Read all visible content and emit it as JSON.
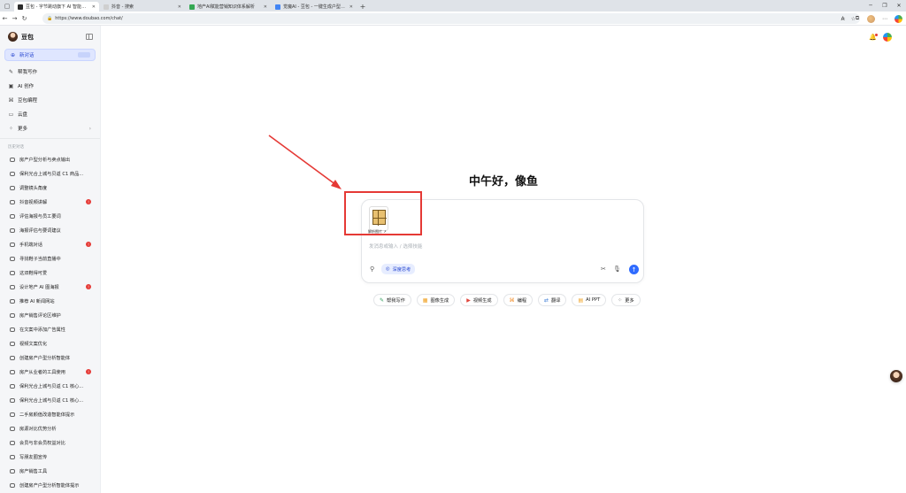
{
  "browser": {
    "tabs": [
      {
        "title": "豆包 - 字节跳动旗下 AI 智能助手",
        "active": true,
        "favicon_color": "#2b2b2b"
      },
      {
        "title": "抖音 - 搜索",
        "active": false,
        "favicon_color": "#cfcfcf"
      },
      {
        "title": "地产AI赋能营销知识体系解析",
        "active": false,
        "favicon_color": "#34a853"
      },
      {
        "title": "觉魔AI - 豆包 - 一键生成户型解析",
        "active": false,
        "favicon_color": "#4285f4"
      }
    ],
    "tab_close": "✕",
    "new_tab": "+",
    "url": "https://www.doubao.com/chat/"
  },
  "sidebar": {
    "app_name": "豆包",
    "new_chat": "新对话",
    "nav": [
      {
        "label": "帮我写作",
        "icon": "✎"
      },
      {
        "label": "AI 创作",
        "icon": "▣"
      },
      {
        "label": "豆包编程",
        "icon": "⌘"
      },
      {
        "label": "云盘",
        "icon": "▭"
      },
      {
        "label": "更多",
        "icon": "⁘"
      }
    ],
    "section_title": "历史对话",
    "history": [
      {
        "label": "房产户型分析与卖点输出",
        "badge": false
      },
      {
        "label": "保利光合上城与贝返 C1 商品...",
        "badge": false
      },
      {
        "label": "调整镜头角度",
        "badge": false
      },
      {
        "label": "抖音视频讲解",
        "badge": true
      },
      {
        "label": "评估海报与员工要词",
        "badge": false
      },
      {
        "label": "海报评估与要词建议",
        "badge": false
      },
      {
        "label": "手机端对话",
        "badge": true
      },
      {
        "label": "寻找鞋子当前直播中",
        "badge": false
      },
      {
        "label": "这双鞋得可爱",
        "badge": false
      },
      {
        "label": "设计地产 AI 图海报",
        "badge": true
      },
      {
        "label": "推荐 AI 新闻网站",
        "badge": false
      },
      {
        "label": "房产销售评论区维护",
        "badge": false
      },
      {
        "label": "在文案中添加广告属性",
        "badge": false
      },
      {
        "label": "视频文案优化",
        "badge": false
      },
      {
        "label": "创建房产户型分析智能体",
        "badge": false
      },
      {
        "label": "房产从业者的工具使用",
        "badge": true
      },
      {
        "label": "保利光合上城与贝返 C1 核心...",
        "badge": false
      },
      {
        "label": "保利光合上城与贝返 C1 核心...",
        "badge": false
      },
      {
        "label": "二手房颜值改造智能体提示",
        "badge": false
      },
      {
        "label": "房源对比优势分析",
        "badge": false
      },
      {
        "label": "会员与非会员权益对比",
        "badge": false
      },
      {
        "label": "写朋友圈宣传",
        "badge": false
      },
      {
        "label": "房产销售工具",
        "badge": false
      },
      {
        "label": "创建房产户型分析智能体提示",
        "badge": false
      }
    ],
    "badge_text": "!"
  },
  "main": {
    "greeting": "中午好，像鱼",
    "attachment_label": "解析图片 ↗",
    "input_placeholder": "发消息或输入 / 选择技能",
    "deep_think": "深度思考",
    "skills": [
      {
        "label": "帮我写作",
        "icon": "✎",
        "color": "#2e9d5b"
      },
      {
        "label": "图像生成",
        "icon": "▦",
        "color": "#f0a020"
      },
      {
        "label": "视频生成",
        "icon": "▶",
        "color": "#e0463c"
      },
      {
        "label": "编程",
        "icon": "⌘",
        "color": "#f08a24"
      },
      {
        "label": "翻译",
        "icon": "⇄",
        "color": "#3a7bd5"
      },
      {
        "label": "AI PPT",
        "icon": "▤",
        "color": "#f0a020"
      },
      {
        "label": "更多",
        "icon": "⁘",
        "color": "#555555"
      }
    ]
  },
  "colors": {
    "accent": "#2f6bff",
    "annotation": "#e53935"
  }
}
